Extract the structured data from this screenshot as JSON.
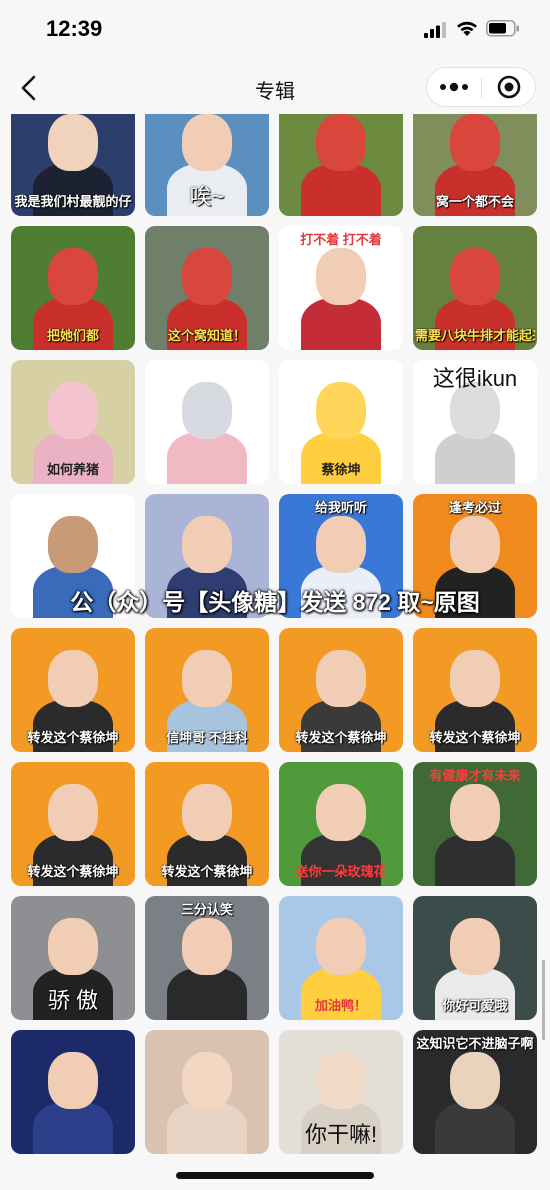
{
  "status_bar": {
    "time": "12:39"
  },
  "nav": {
    "title": "专辑"
  },
  "overlay_text": "公（众）号【头像糖】发送 872 取~原图",
  "tiles": [
    {
      "caption": "我是我们村最靓的仔",
      "pos": "bottom",
      "bg": "#2c3e6b",
      "face": "#f1d2bd",
      "body": "#1d2233",
      "color": "#ffffff"
    },
    {
      "caption": "唉~",
      "pos": "bottom",
      "bg": "#5a8fbf",
      "face": "#f0cdb4",
      "body": "#e9edf2",
      "color": "#ffffff",
      "big": true
    },
    {
      "caption": "",
      "pos": "bottom",
      "bg": "#6c8b3e",
      "face": "#d9463c",
      "body": "#c9302c",
      "color": "#ffffff"
    },
    {
      "caption": "窝一个都不会",
      "pos": "bottom",
      "bg": "#7f8e5a",
      "face": "#d9463c",
      "body": "#c9302c",
      "color": "#ffffff"
    },
    {
      "caption": "把她们都",
      "pos": "bottom",
      "bg": "#4f7e33",
      "face": "#d9463c",
      "body": "#c9302c",
      "color": "#ffe14d"
    },
    {
      "caption": "这个窝知道！",
      "pos": "bottom",
      "bg": "#6f7f6a",
      "face": "#d9463c",
      "body": "#c9302c",
      "color": "#ffe14d"
    },
    {
      "caption": "打不着 打不着",
      "pos": "top",
      "bg": "#ffffff",
      "face": "#f0cdb4",
      "body": "#c42d38",
      "color": "#e23b3b"
    },
    {
      "caption": "需要八块牛排才能起来",
      "pos": "bottom",
      "bg": "#66803f",
      "face": "#d9463c",
      "body": "#c9302c",
      "color": "#ffe14d"
    },
    {
      "caption": "如何养猪",
      "pos": "bottom",
      "bg": "#d7d0a4",
      "face": "#f3c3cf",
      "body": "#ebb2c4",
      "color": "#222222"
    },
    {
      "caption": "",
      "pos": "bottom",
      "bg": "#ffffff",
      "face": "#d7d9e0",
      "body": "#f1b9c2",
      "color": "#222222"
    },
    {
      "caption": "蔡徐坤",
      "pos": "bottom",
      "bg": "#ffffff",
      "face": "#ffd65a",
      "body": "#ffcf3f",
      "color": "#222222"
    },
    {
      "caption": "这很ikun",
      "pos": "top",
      "bg": "#ffffff",
      "face": "#dcdcdc",
      "body": "#cfcfcf",
      "color": "#111111",
      "big": true
    },
    {
      "caption": "",
      "pos": "bottom",
      "bg": "#ffffff",
      "face": "#c99a78",
      "body": "#3a6bb8",
      "color": "#222222"
    },
    {
      "caption": "",
      "pos": "bottom",
      "bg": "#a9b4d6",
      "face": "#f0cdb4",
      "body": "#2f3e72",
      "color": "#ffffff"
    },
    {
      "caption": "给我听听",
      "pos": "top",
      "bg": "#3a78d8",
      "face": "#f0cdb4",
      "body": "#e9eef7",
      "color": "#ffffff"
    },
    {
      "caption": "逢考必过",
      "pos": "top",
      "bg": "#f08a1c",
      "face": "#f0cdb4",
      "body": "#222222",
      "color": "#ffffff"
    },
    {
      "caption": "转发这个蔡徐坤",
      "pos": "bottom",
      "bg": "#f29a24",
      "face": "#f0cdb4",
      "body": "#2b2b2b",
      "color": "#ffffff"
    },
    {
      "caption": "信坤哥 不挂科",
      "pos": "bottom",
      "bg": "#f29a24",
      "face": "#f0cdb4",
      "body": "#a8c3de",
      "color": "#ffffff"
    },
    {
      "caption": "转发这个蔡徐坤",
      "pos": "bottom",
      "bg": "#f29a24",
      "face": "#f0cdb4",
      "body": "#3a3a3a",
      "color": "#ffffff"
    },
    {
      "caption": "转发这个蔡徐坤",
      "pos": "bottom",
      "bg": "#f29a24",
      "face": "#f0cdb4",
      "body": "#2b2b2b",
      "color": "#ffffff"
    },
    {
      "caption": "转发这个蔡徐坤",
      "pos": "bottom",
      "bg": "#f29a24",
      "face": "#f0cdb4",
      "body": "#2b2b2b",
      "color": "#ffffff"
    },
    {
      "caption": "转发这个蔡徐坤",
      "pos": "bottom",
      "bg": "#f29a24",
      "face": "#f0cdb4",
      "body": "#2b2b2b",
      "color": "#ffffff"
    },
    {
      "caption": "送你一朵玫瑰花",
      "pos": "bottom",
      "bg": "#4f9a3a",
      "face": "#f0cdb4",
      "body": "#333333",
      "color": "#ff3b3b"
    },
    {
      "caption": "有健康才有未来",
      "pos": "top",
      "bg": "#3f6a35",
      "face": "#f0cdb4",
      "body": "#2f2f2f",
      "color": "#ff3b3b"
    },
    {
      "caption": "骄 傲",
      "pos": "bottom",
      "bg": "#8d8f92",
      "face": "#f0cdb4",
      "body": "#222222",
      "color": "#ffffff",
      "big": true
    },
    {
      "caption": "三分认笑",
      "pos": "top",
      "bg": "#7b7f86",
      "face": "#f0cdb4",
      "body": "#2a2a2a",
      "color": "#ffffff"
    },
    {
      "caption": "加油鸭！",
      "pos": "bottom",
      "bg": "#a9c8e8",
      "face": "#f0cdb4",
      "body": "#ffcf3f",
      "color": "#e23b3b"
    },
    {
      "caption": "你好可爱哦",
      "pos": "bottom",
      "bg": "#3b4c4a",
      "face": "#f0cdb4",
      "body": "#eaeaea",
      "color": "#ffffff"
    },
    {
      "caption": "",
      "pos": "bottom",
      "bg": "#1c2a6a",
      "face": "#f0cdb4",
      "body": "#2c3f8a",
      "color": "#ffffff"
    },
    {
      "caption": "",
      "pos": "bottom",
      "bg": "#d9c2b0",
      "face": "#f3d7c2",
      "body": "#e8d4c4",
      "color": "#222222"
    },
    {
      "caption": "你干嘛!",
      "pos": "bottom",
      "bg": "#e4dfd6",
      "face": "#f2dac8",
      "body": "#d8d0c4",
      "color": "#111111",
      "big": true
    },
    {
      "caption": "这知识它不进脑子啊",
      "pos": "top",
      "bg": "#2a2a2a",
      "face": "#e9d3bd",
      "body": "#3a3a3a",
      "color": "#ffffff"
    }
  ]
}
